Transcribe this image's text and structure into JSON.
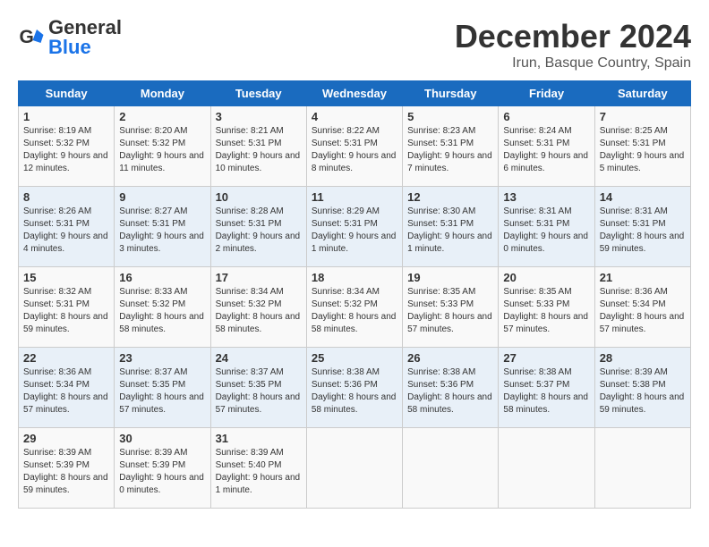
{
  "header": {
    "logo_text_general": "General",
    "logo_text_blue": "Blue",
    "month_title": "December 2024",
    "location": "Irun, Basque Country, Spain"
  },
  "calendar": {
    "days_of_week": [
      "Sunday",
      "Monday",
      "Tuesday",
      "Wednesday",
      "Thursday",
      "Friday",
      "Saturday"
    ],
    "weeks": [
      [
        null,
        null,
        null,
        null,
        null,
        null,
        null
      ]
    ],
    "cells": [
      {
        "day": null,
        "info": ""
      },
      {
        "day": null,
        "info": ""
      },
      {
        "day": null,
        "info": ""
      },
      {
        "day": null,
        "info": ""
      },
      {
        "day": null,
        "info": ""
      },
      {
        "day": null,
        "info": ""
      },
      {
        "day": null,
        "info": ""
      }
    ]
  },
  "rows": [
    [
      {
        "day": "1",
        "sunrise": "8:19 AM",
        "sunset": "5:32 PM",
        "daylight": "9 hours and 12 minutes."
      },
      {
        "day": "2",
        "sunrise": "8:20 AM",
        "sunset": "5:32 PM",
        "daylight": "9 hours and 11 minutes."
      },
      {
        "day": "3",
        "sunrise": "8:21 AM",
        "sunset": "5:31 PM",
        "daylight": "9 hours and 10 minutes."
      },
      {
        "day": "4",
        "sunrise": "8:22 AM",
        "sunset": "5:31 PM",
        "daylight": "9 hours and 8 minutes."
      },
      {
        "day": "5",
        "sunrise": "8:23 AM",
        "sunset": "5:31 PM",
        "daylight": "9 hours and 7 minutes."
      },
      {
        "day": "6",
        "sunrise": "8:24 AM",
        "sunset": "5:31 PM",
        "daylight": "9 hours and 6 minutes."
      },
      {
        "day": "7",
        "sunrise": "8:25 AM",
        "sunset": "5:31 PM",
        "daylight": "9 hours and 5 minutes."
      }
    ],
    [
      {
        "day": "8",
        "sunrise": "8:26 AM",
        "sunset": "5:31 PM",
        "daylight": "9 hours and 4 minutes."
      },
      {
        "day": "9",
        "sunrise": "8:27 AM",
        "sunset": "5:31 PM",
        "daylight": "9 hours and 3 minutes."
      },
      {
        "day": "10",
        "sunrise": "8:28 AM",
        "sunset": "5:31 PM",
        "daylight": "9 hours and 2 minutes."
      },
      {
        "day": "11",
        "sunrise": "8:29 AM",
        "sunset": "5:31 PM",
        "daylight": "9 hours and 1 minute."
      },
      {
        "day": "12",
        "sunrise": "8:30 AM",
        "sunset": "5:31 PM",
        "daylight": "9 hours and 1 minute."
      },
      {
        "day": "13",
        "sunrise": "8:31 AM",
        "sunset": "5:31 PM",
        "daylight": "9 hours and 0 minutes."
      },
      {
        "day": "14",
        "sunrise": "8:31 AM",
        "sunset": "5:31 PM",
        "daylight": "8 hours and 59 minutes."
      }
    ],
    [
      {
        "day": "15",
        "sunrise": "8:32 AM",
        "sunset": "5:31 PM",
        "daylight": "8 hours and 59 minutes."
      },
      {
        "day": "16",
        "sunrise": "8:33 AM",
        "sunset": "5:32 PM",
        "daylight": "8 hours and 58 minutes."
      },
      {
        "day": "17",
        "sunrise": "8:34 AM",
        "sunset": "5:32 PM",
        "daylight": "8 hours and 58 minutes."
      },
      {
        "day": "18",
        "sunrise": "8:34 AM",
        "sunset": "5:32 PM",
        "daylight": "8 hours and 58 minutes."
      },
      {
        "day": "19",
        "sunrise": "8:35 AM",
        "sunset": "5:33 PM",
        "daylight": "8 hours and 57 minutes."
      },
      {
        "day": "20",
        "sunrise": "8:35 AM",
        "sunset": "5:33 PM",
        "daylight": "8 hours and 57 minutes."
      },
      {
        "day": "21",
        "sunrise": "8:36 AM",
        "sunset": "5:34 PM",
        "daylight": "8 hours and 57 minutes."
      }
    ],
    [
      {
        "day": "22",
        "sunrise": "8:36 AM",
        "sunset": "5:34 PM",
        "daylight": "8 hours and 57 minutes."
      },
      {
        "day": "23",
        "sunrise": "8:37 AM",
        "sunset": "5:35 PM",
        "daylight": "8 hours and 57 minutes."
      },
      {
        "day": "24",
        "sunrise": "8:37 AM",
        "sunset": "5:35 PM",
        "daylight": "8 hours and 57 minutes."
      },
      {
        "day": "25",
        "sunrise": "8:38 AM",
        "sunset": "5:36 PM",
        "daylight": "8 hours and 58 minutes."
      },
      {
        "day": "26",
        "sunrise": "8:38 AM",
        "sunset": "5:36 PM",
        "daylight": "8 hours and 58 minutes."
      },
      {
        "day": "27",
        "sunrise": "8:38 AM",
        "sunset": "5:37 PM",
        "daylight": "8 hours and 58 minutes."
      },
      {
        "day": "28",
        "sunrise": "8:39 AM",
        "sunset": "5:38 PM",
        "daylight": "8 hours and 59 minutes."
      }
    ],
    [
      {
        "day": "29",
        "sunrise": "8:39 AM",
        "sunset": "5:39 PM",
        "daylight": "8 hours and 59 minutes."
      },
      {
        "day": "30",
        "sunrise": "8:39 AM",
        "sunset": "5:39 PM",
        "daylight": "9 hours and 0 minutes."
      },
      {
        "day": "31",
        "sunrise": "8:39 AM",
        "sunset": "5:40 PM",
        "daylight": "9 hours and 1 minute."
      },
      null,
      null,
      null,
      null
    ]
  ]
}
